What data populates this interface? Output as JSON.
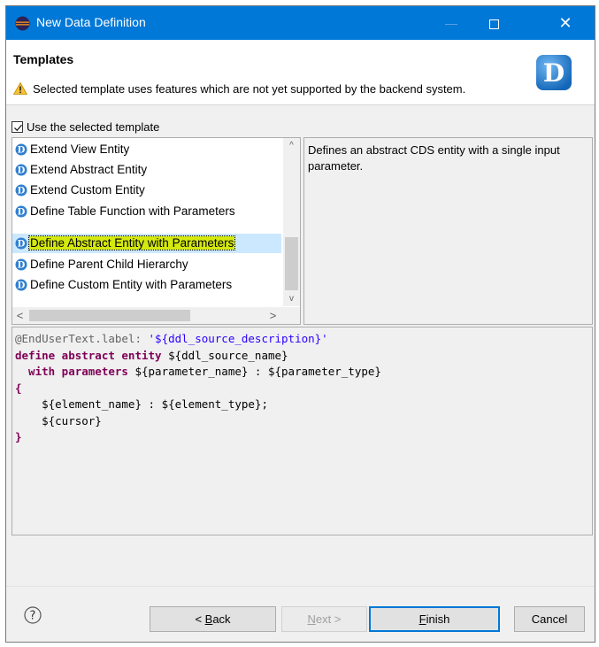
{
  "window": {
    "title": "New Data Definition",
    "minimize_symbol": "—",
    "close_symbol": "✕"
  },
  "banner": {
    "heading": "Templates",
    "message": "Selected template uses features which are not yet supported by the backend system.",
    "logo_letter": "D",
    "warning_icon": "warning-triangle-icon"
  },
  "use_template": {
    "label": "Use the selected template",
    "checked": true
  },
  "templates": {
    "items": [
      {
        "label": "Extend View Entity"
      },
      {
        "label": "Extend Abstract Entity"
      },
      {
        "label": "Extend Custom Entity"
      },
      {
        "label": "Define Table Function with Parameters"
      },
      {
        "label": "Define Abstract Entity with Parameters",
        "selected": true
      },
      {
        "label": "Define Parent Child Hierarchy"
      },
      {
        "label": "Define Custom Entity with Parameters"
      }
    ],
    "scroll_up": "^",
    "scroll_down": "v",
    "scroll_left": "<",
    "scroll_right": ">"
  },
  "description": "Defines an abstract CDS entity with a single input parameter.",
  "preview": {
    "line1_anno": "@EndUserText.label: ",
    "line1_str": "'${ddl_source_description}'",
    "line2_kw": "define abstract entity ",
    "line2_var": "${ddl_source_name}",
    "line3_kw": "  with parameters ",
    "line3_var1": "${parameter_name}",
    "line3_sep": " : ",
    "line3_var2": "${parameter_type}",
    "line4": "{",
    "line5_var1": "    ${element_name}",
    "line5_sep": " : ",
    "line5_var2": "${element_type}",
    "line5_end": ";",
    "line6_var": "    ${cursor}",
    "line7": "}"
  },
  "buttons": {
    "help_symbol": "?",
    "back_mnemonic": "B",
    "back_rest": "ack",
    "back_prefix": "< ",
    "next_mnemonic": "N",
    "next_rest": "ext >",
    "finish_mnemonic": "F",
    "finish_rest": "inish",
    "cancel": "Cancel"
  },
  "colors": {
    "titlebar": "#0078d7",
    "highlight": "#d4e90e",
    "keyword": "#7f0055",
    "string": "#2a00ff",
    "annotation": "#646464"
  }
}
